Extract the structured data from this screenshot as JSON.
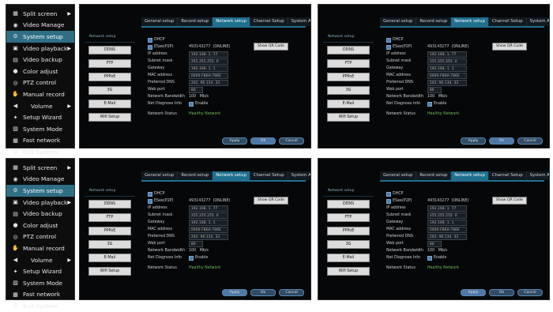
{
  "menu": {
    "items": [
      {
        "label": "Split screen",
        "icon": "grid-icon",
        "glyph": "▦",
        "arrow": "▶"
      },
      {
        "label": "Video Manage",
        "icon": "camera-icon",
        "glyph": "◉",
        "arrow": ""
      },
      {
        "label": "System setup",
        "icon": "gear-icon",
        "glyph": "⚙",
        "arrow": ""
      },
      {
        "label": "Video playback",
        "icon": "film-icon",
        "glyph": "▣",
        "arrow": "▶"
      },
      {
        "label": "Video backup",
        "icon": "save-icon",
        "glyph": "▤",
        "arrow": ""
      },
      {
        "label": "Color adjust",
        "icon": "palette-icon",
        "glyph": "●",
        "arrow": ""
      },
      {
        "label": "PTZ control",
        "icon": "ptz-icon",
        "glyph": "◎",
        "arrow": ""
      },
      {
        "label": "Manual record",
        "icon": "hand-icon",
        "glyph": "✋",
        "arrow": ""
      },
      {
        "label": "Volume",
        "icon": "speaker-icon",
        "glyph": "◀",
        "arrow": "▶"
      },
      {
        "label": "Setup Wizard",
        "icon": "wand-icon",
        "glyph": "✦",
        "arrow": ""
      },
      {
        "label": "System Mode",
        "icon": "document-icon",
        "glyph": "▧",
        "arrow": ""
      },
      {
        "label": "Fast network",
        "icon": "network-icon",
        "glyph": "▩",
        "arrow": ""
      },
      {
        "label": "Exit System",
        "icon": "power-icon",
        "glyph": "⏻",
        "arrow": ""
      }
    ]
  },
  "tabs": [
    "General setup",
    "Record setup",
    "Network setup",
    "Channel Setup",
    "System Admin"
  ],
  "side": {
    "header": "Network setup",
    "buttons": [
      "DDNS",
      "FTP",
      "PPPoE",
      "3G",
      "E-Mail",
      "Wifi Setup"
    ]
  },
  "form": {
    "dhcp": "DHCP",
    "esee_label": "ESee(P2P)",
    "esee_id": "493143277",
    "esee_status": "(ONLINE)",
    "qr_button": "Show QR Code",
    "ip_label": "IP address",
    "ip_value": "192.168.  1. 77",
    "mask_label": "Subnet mask",
    "mask_value": "255.255.255.  0",
    "gw_label": "Gateway",
    "gw_value": "192.168.  1.  1",
    "mac_label": "MAC address",
    "mac_value": "0000-FB6A-786E",
    "dns_label": "Preferred DNS",
    "dns_value": "202. 96.134. 33",
    "port_label": "Web port",
    "port_value": "80",
    "bw_label": "Network Bandwidth",
    "bw_value": "100",
    "bw_unit": "Mb/s",
    "diag_label": "Net Diagnose Info",
    "diag_value": "Enable",
    "status_label": "Network Status",
    "status_value": "Healthy Network"
  },
  "buttons": {
    "apply": "Apply",
    "ok": "Ok",
    "cancel": "Cancel"
  },
  "colors": {
    "accent": "#1f6f8f",
    "menu_selected": "#2f6f86",
    "status_green": "#6fbf5a"
  }
}
